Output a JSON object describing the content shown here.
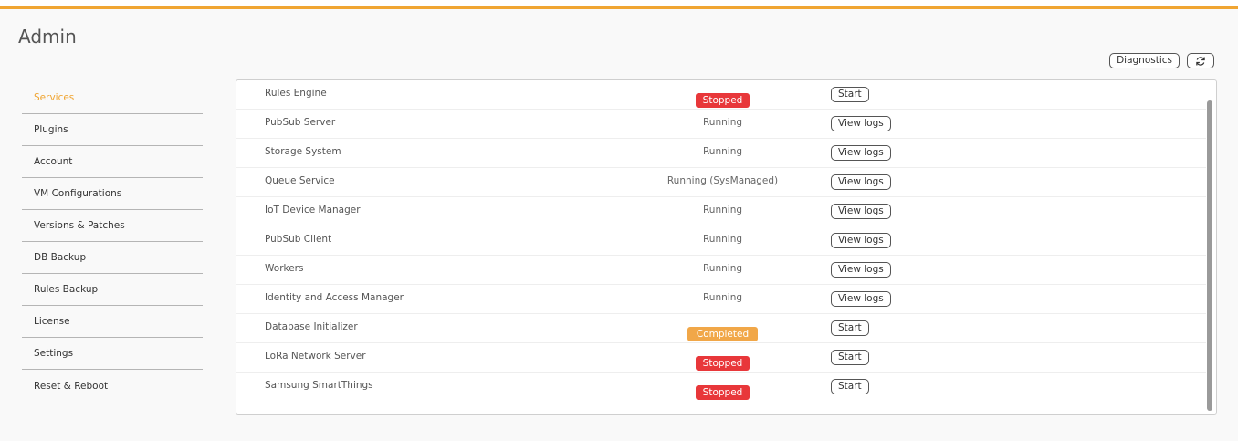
{
  "page": {
    "title": "Admin"
  },
  "top_actions": {
    "diagnostics_label": "Diagnostics",
    "refresh_icon": "refresh-icon"
  },
  "sidebar": {
    "items": [
      {
        "label": "Services",
        "active": true
      },
      {
        "label": "Plugins"
      },
      {
        "label": "Account"
      },
      {
        "label": "VM Configurations"
      },
      {
        "label": "Versions & Patches"
      },
      {
        "label": "DB Backup"
      },
      {
        "label": "Rules Backup"
      },
      {
        "label": "License"
      },
      {
        "label": "Settings"
      },
      {
        "label": "Reset & Reboot"
      }
    ]
  },
  "services": [
    {
      "name": "Rules Engine",
      "status": "Stopped",
      "status_type": "stopped",
      "action": "Start"
    },
    {
      "name": "PubSub Server",
      "status": "Running",
      "status_type": "text",
      "action": "View logs"
    },
    {
      "name": "Storage System",
      "status": "Running",
      "status_type": "text",
      "action": "View logs"
    },
    {
      "name": "Queue Service",
      "status": "Running (SysManaged)",
      "status_type": "text",
      "action": "View logs"
    },
    {
      "name": "IoT Device Manager",
      "status": "Running",
      "status_type": "text",
      "action": "View logs"
    },
    {
      "name": "PubSub Client",
      "status": "Running",
      "status_type": "text",
      "action": "View logs"
    },
    {
      "name": "Workers",
      "status": "Running",
      "status_type": "text",
      "action": "View logs"
    },
    {
      "name": "Identity and Access Manager",
      "status": "Running",
      "status_type": "text",
      "action": "View logs"
    },
    {
      "name": "Database Initializer",
      "status": "Completed",
      "status_type": "completed",
      "action": "Start"
    },
    {
      "name": "LoRa Network Server",
      "status": "Stopped",
      "status_type": "stopped",
      "action": "Start"
    },
    {
      "name": "Samsung SmartThings",
      "status": "Stopped",
      "status_type": "stopped",
      "action": "Start"
    }
  ],
  "colors": {
    "accent": "#f0a532",
    "stopped": "#e8373a",
    "completed": "#f1a748"
  }
}
